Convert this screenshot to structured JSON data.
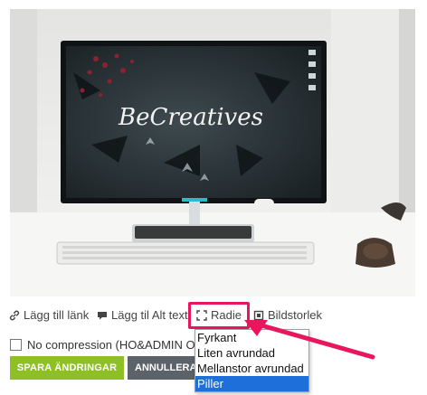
{
  "toolbar": {
    "link_label": "Lägg till länk",
    "alt_label": "Lägg til Alt text",
    "radius_label": "Radie",
    "size_label": "Bildstorlek"
  },
  "options": {
    "no_compression_label": "No compression (HO&ADMIN ONLY)"
  },
  "radius_dropdown": {
    "items": [
      "Fyrkant",
      "Liten avrundad",
      "Mellanstor avrundad",
      "Piller"
    ],
    "selected": "Piller"
  },
  "buttons": {
    "save_label": "SPARA ÄNDRINGAR",
    "cancel_label": "ANNULLERA"
  },
  "image": {
    "screen_text": "BeCreatives"
  },
  "colors": {
    "accent_save": "#8ebf24",
    "cancel_bg": "#5b6269",
    "highlight": "#e8175d",
    "selected_option": "#1e6fd9"
  }
}
